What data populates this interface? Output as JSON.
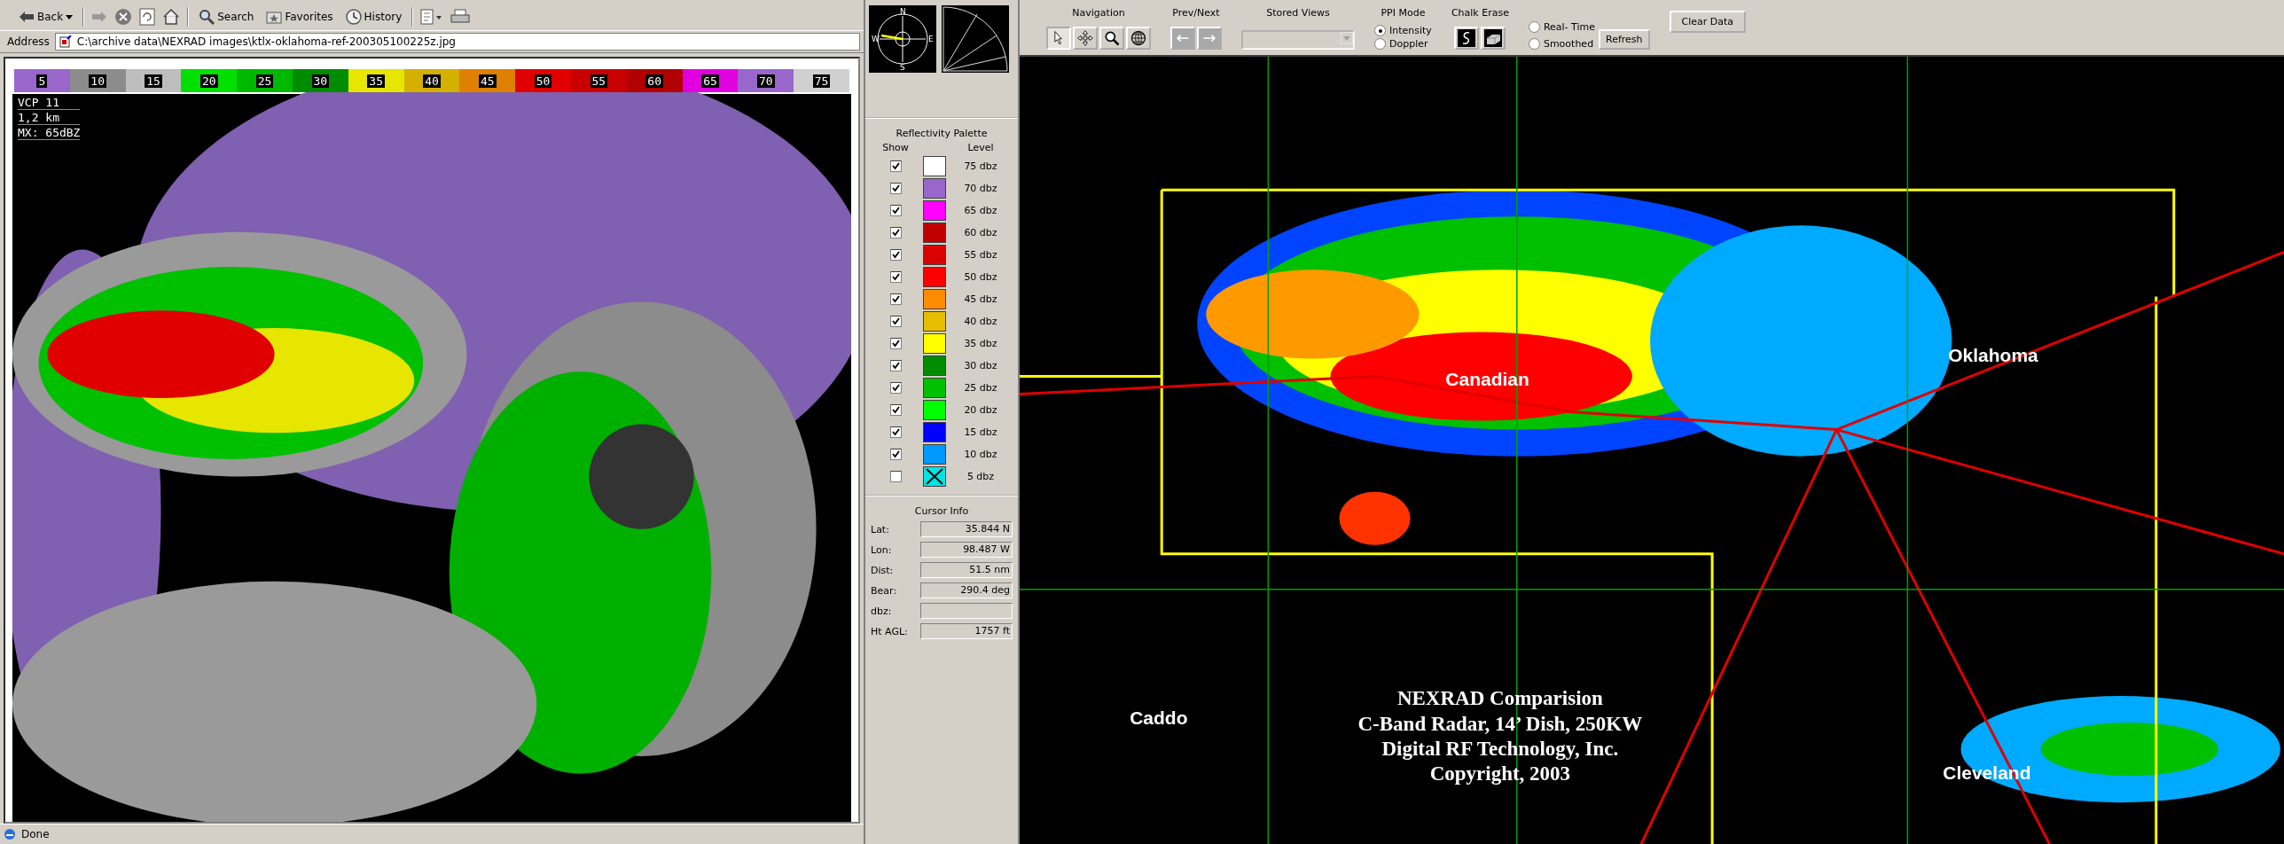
{
  "browser": {
    "toolbar": [
      {
        "kind": "back",
        "label": "Back"
      },
      {
        "kind": "forward"
      },
      {
        "kind": "stop"
      },
      {
        "kind": "refresh"
      },
      {
        "kind": "home"
      },
      {
        "kind": "search",
        "label": "Search"
      },
      {
        "kind": "favorites",
        "label": "Favorites"
      },
      {
        "kind": "history",
        "label": "History"
      },
      {
        "kind": "edit"
      },
      {
        "kind": "print"
      }
    ],
    "address_label": "Address",
    "address": "C:\\archive data\\NEXRAD images\\ktlx-oklahoma-ref-200305100225z.jpg",
    "radar_image": {
      "scale": [
        {
          "label": "5",
          "color": "#9966cc"
        },
        {
          "label": "10",
          "color": "#8c8c8c"
        },
        {
          "label": "15",
          "color": "#bdbdbd"
        },
        {
          "label": "20",
          "color": "#00e000"
        },
        {
          "label": "25",
          "color": "#00b800"
        },
        {
          "label": "30",
          "color": "#008c00"
        },
        {
          "label": "35",
          "color": "#e6e600"
        },
        {
          "label": "40",
          "color": "#d4b000"
        },
        {
          "label": "45",
          "color": "#e08000"
        },
        {
          "label": "50",
          "color": "#e00000"
        },
        {
          "label": "55",
          "color": "#c80000"
        },
        {
          "label": "60",
          "color": "#b00000"
        },
        {
          "label": "65",
          "color": "#e000e0"
        },
        {
          "label": "70",
          "color": "#9966cc"
        },
        {
          "label": "75",
          "color": "#d0d0d0"
        }
      ],
      "info": [
        "VCP 11",
        "1,2 km",
        "MX: 65dBZ"
      ]
    },
    "status": "Done"
  },
  "compass": {
    "north": "N",
    "south": "S",
    "east": "E",
    "west": "W"
  },
  "palette": {
    "title": "Reflectivity Palette",
    "show_header": "Show",
    "level_header": "Level",
    "levels": [
      {
        "label": "75 dbz",
        "color": "#ffffff",
        "checked": true
      },
      {
        "label": "70 dbz",
        "color": "#9966cc",
        "checked": true
      },
      {
        "label": "65 dbz",
        "color": "#ff00ff",
        "checked": true
      },
      {
        "label": "60 dbz",
        "color": "#c00000",
        "checked": true
      },
      {
        "label": "55 dbz",
        "color": "#d80000",
        "checked": true
      },
      {
        "label": "50 dbz",
        "color": "#ff0000",
        "checked": true
      },
      {
        "label": "45 dbz",
        "color": "#ff8c00",
        "checked": true
      },
      {
        "label": "40 dbz",
        "color": "#e6be00",
        "checked": true
      },
      {
        "label": "35 dbz",
        "color": "#ffff00",
        "checked": true
      },
      {
        "label": "30 dbz",
        "color": "#008c00",
        "checked": true
      },
      {
        "label": "25 dbz",
        "color": "#00c000",
        "checked": true
      },
      {
        "label": "20 dbz",
        "color": "#00ff00",
        "checked": true
      },
      {
        "label": "15 dbz",
        "color": "#0000ff",
        "checked": true
      },
      {
        "label": "10 dbz",
        "color": "#0099ff",
        "checked": true
      },
      {
        "label": "5 dbz",
        "color": "#00e5e5",
        "checked": false
      }
    ]
  },
  "cursor_info": {
    "title": "Cursor Info",
    "fields": [
      {
        "label": "Lat:",
        "value": "35.844 N"
      },
      {
        "label": "Lon:",
        "value": "98.487 W"
      },
      {
        "label": "Dist:",
        "value": "51.5 nm"
      },
      {
        "label": "Bear:",
        "value": "290.4 deg"
      },
      {
        "label": "dbz:"
      },
      {
        "label": "Ht AGL:",
        "value": "1757 ft"
      }
    ]
  },
  "toolbar": {
    "navigation": {
      "title": "Navigation",
      "tools": [
        {
          "kind": "pointer",
          "selected": true
        },
        {
          "kind": "pan",
          "selected": false
        },
        {
          "kind": "zoom",
          "selected": false
        },
        {
          "kind": "globe",
          "selected": false
        }
      ]
    },
    "prev_next": {
      "title": "Prev/Next",
      "disabled": true
    },
    "stored_views": {
      "title": "Stored Views",
      "disabled": true
    },
    "ppi_mode": {
      "title": "PPI Mode",
      "options": [
        {
          "label": "Intensity",
          "selected": true
        },
        {
          "label": "Doppler",
          "selected": false
        }
      ]
    },
    "chalk_erase": {
      "title": "Chalk Erase"
    },
    "update": {
      "options": [
        {
          "label": "Real- Time",
          "selected": false
        },
        {
          "label": "Smoothed",
          "selected": false
        }
      ],
      "refresh": "Refresh"
    },
    "clear": "Clear Data"
  },
  "map": {
    "labels": [
      {
        "text": "Canadian"
      },
      {
        "text": "Oklahoma"
      },
      {
        "text": "Caddo"
      },
      {
        "text": "Cleveland"
      }
    ],
    "caption": [
      "NEXRAD Comparision",
      "C-Band Radar, 14’ Dish, 250KW",
      "Digital RF Technology, Inc.",
      "Copyright, 2003"
    ]
  }
}
